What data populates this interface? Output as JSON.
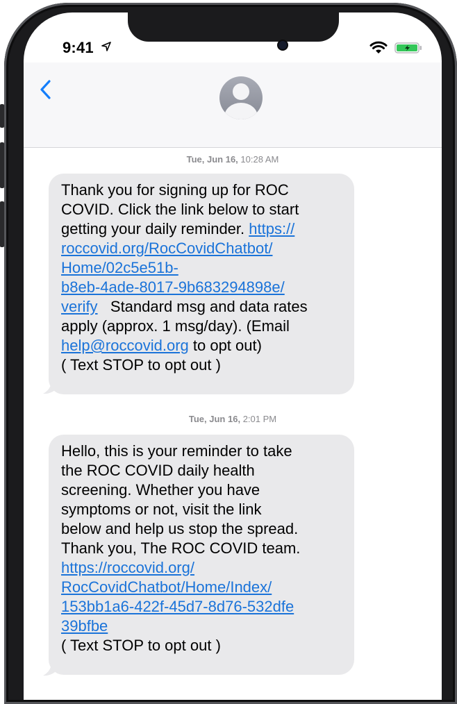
{
  "status_bar": {
    "time": "9:41"
  },
  "conversation": {
    "messages": [
      {
        "timestamp_day": "Tue, Jun 16,",
        "timestamp_time": "10:28 AM",
        "lines": [
          "Thank you for signing up for ROC",
          "COVID. Click the link below to start",
          "getting your daily reminder. ",
          "https://",
          "roccovid.org/RocCovidChatbot/",
          "Home/02c5e51b-",
          "b8eb-4ade-8017-9b683294898e/",
          "verify",
          "   Standard msg and data rates",
          "apply (approx. 1 msg/day). (Email",
          "help@roccovid.org",
          " to opt out)",
          "( Text STOP to opt out )"
        ]
      },
      {
        "timestamp_day": "Tue, Jun 16,",
        "timestamp_time": "2:01 PM",
        "lines": [
          "Hello, this is your reminder to take",
          "the ROC COVID daily health",
          "screening. Whether you have",
          "symptoms or not, visit the link",
          "below and help us stop the spread.",
          "Thank you, The ROC COVID team.",
          "https://roccovid.org/",
          "RocCovidChatbot/Home/Index/",
          "153bb1a6-422f-45d7-8d76-532dfe",
          "39bfbe",
          "( Text STOP to opt out )"
        ]
      }
    ]
  },
  "colors": {
    "link": "#1a73d9",
    "bubble_incoming": "#e9e9eb",
    "ios_blue": "#147efb",
    "battery_green": "#34c759"
  },
  "icons": [
    "location-arrow-icon",
    "wifi-icon",
    "battery-icon",
    "back-chevron-icon",
    "contact-avatar-icon"
  ]
}
